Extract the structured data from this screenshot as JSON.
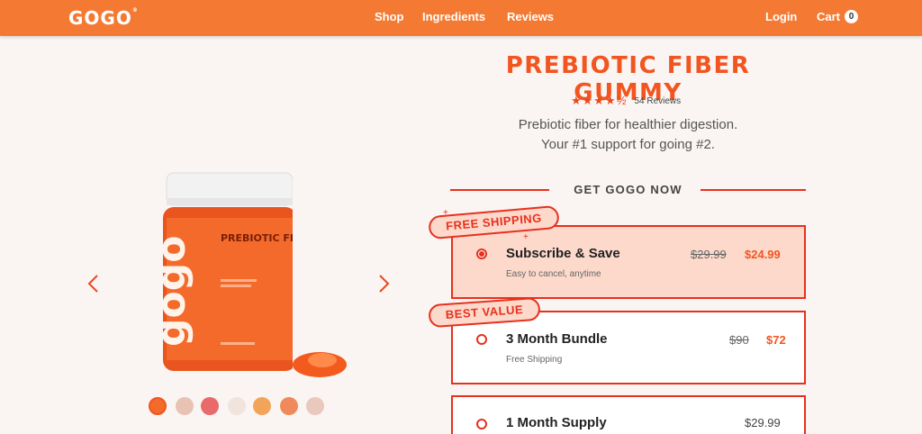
{
  "brand": {
    "logo": "GOGO",
    "accent": "#f47a33",
    "red": "#e8301e"
  },
  "nav": {
    "links": [
      "Shop",
      "Ingredients",
      "Reviews"
    ],
    "login": "Login",
    "cart_label": "Cart",
    "cart_count": "0"
  },
  "gallery": {
    "jar_brand": "gogo",
    "jar_title": "PREBIOTIC FIBER",
    "prev_icon": "chevron-left-icon",
    "next_icon": "chevron-right-icon",
    "thumbnail_count": 7
  },
  "product": {
    "title": "PREBIOTIC FIBER GUMMY",
    "rating": 4.5,
    "stars": "★★★★½",
    "reviews": "54 Reviews",
    "tagline_1": "Prebiotic fiber for healthier digestion.",
    "tagline_2": "Your #1 support for going #2."
  },
  "purchase": {
    "heading": "GET GOGO NOW",
    "options": [
      {
        "badge": "FREE SHIPPING",
        "name": "Subscribe & Save",
        "sub": "Easy to cancel, anytime",
        "old_price": "$29.99",
        "price": "$24.99",
        "selected": true
      },
      {
        "badge": "BEST VALUE",
        "name": "3 Month Bundle",
        "sub": "Free Shipping",
        "old_price": "$90",
        "price": "$72",
        "selected": false
      },
      {
        "name": "1 Month Supply",
        "price": "$29.99",
        "selected": false
      }
    ]
  }
}
